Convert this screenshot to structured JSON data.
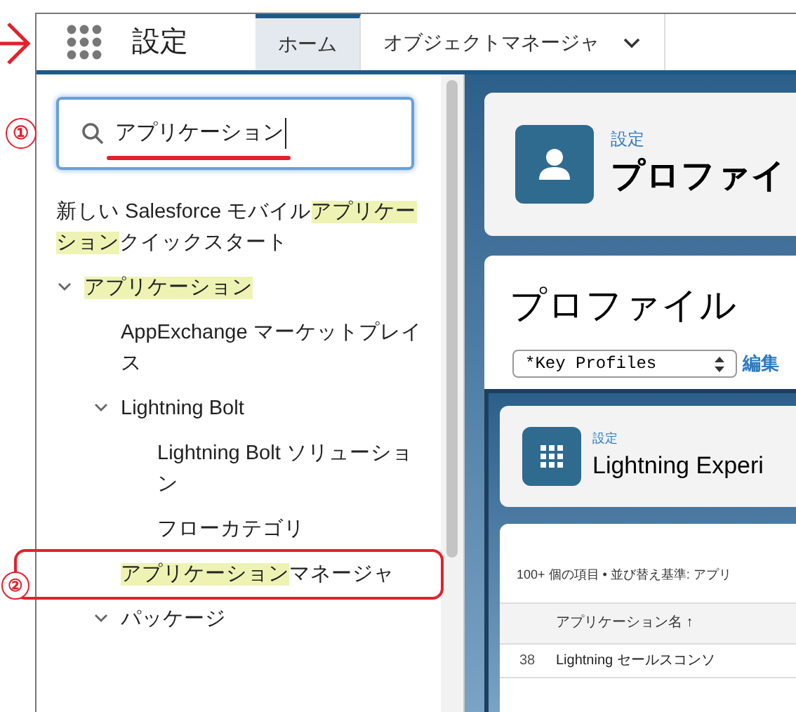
{
  "header": {
    "title": "設定",
    "tabs": [
      {
        "label": "ホーム",
        "selected": true,
        "dropdown": false
      },
      {
        "label": "オブジェクトマネージャ",
        "selected": false,
        "dropdown": true
      }
    ]
  },
  "search": {
    "value": "アプリケーション",
    "underlined": true,
    "callout": "①"
  },
  "tree": [
    {
      "segments": [
        {
          "text": "新しい Salesforce モバイル",
          "highlight": false
        },
        {
          "text": "アプリケーション",
          "highlight": true
        },
        {
          "text": "クイックスタート",
          "highlight": false
        }
      ]
    },
    {
      "segments": [
        {
          "text": "アプリケーション",
          "highlight": true
        }
      ],
      "expanded": true,
      "children": [
        {
          "segments": [
            {
              "text": "AppExchange マーケットプレイス",
              "highlight": false
            }
          ]
        },
        {
          "segments": [
            {
              "text": "Lightning Bolt",
              "highlight": false
            }
          ],
          "expanded": true,
          "children": [
            {
              "segments": [
                {
                  "text": "Lightning Bolt ソリューション",
                  "highlight": false
                }
              ]
            },
            {
              "segments": [
                {
                  "text": "フローカテゴリ",
                  "highlight": false
                }
              ]
            }
          ]
        },
        {
          "segments": [
            {
              "text": "アプリケーション",
              "highlight": true
            },
            {
              "text": "マネージャ",
              "highlight": false
            }
          ],
          "outlined": true,
          "callout": "②"
        },
        {
          "segments": [
            {
              "text": "パッケージ",
              "highlight": false
            }
          ],
          "expanded": true
        }
      ]
    }
  ],
  "profile_header": {
    "breadcrumb": "設定",
    "title": "プロファイ"
  },
  "profile_page": {
    "title": "プロファイル",
    "view_select": "*Key Profiles",
    "edit_link": "編集"
  },
  "app_header": {
    "breadcrumb": "設定",
    "title": "Lightning Experi"
  },
  "app_list": {
    "summary": "100+ 個の項目 • 並び替え基準: アプリ",
    "columns": [
      "アプリケーション名 ↑"
    ],
    "rows": [
      {
        "number": "38",
        "name": "Lightning セールスコンソ"
      }
    ]
  }
}
